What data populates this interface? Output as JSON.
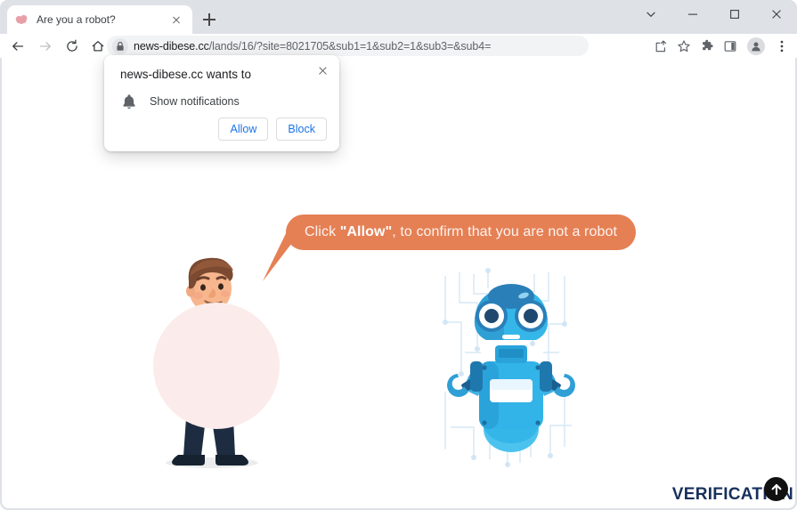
{
  "window": {
    "controls": {
      "tab_search": "tab-search-chevron",
      "minimize": "minimize",
      "maximize": "maximize",
      "close": "close"
    }
  },
  "tabs": [
    {
      "title": "Are you a robot?",
      "favicon": "page-favicon",
      "close_label": "close-tab"
    }
  ],
  "new_tab_label": "new-tab",
  "toolbar": {
    "back": "back",
    "forward": "forward",
    "reload": "reload",
    "home": "home",
    "share": "share",
    "bookmark": "bookmark-star",
    "extensions": "extensions-puzzle",
    "side_panel": "side-panel",
    "profile": "profile-avatar",
    "menu": "three-dot-menu"
  },
  "omnibox": {
    "lock_icon": "lock-icon",
    "host": "news-dibese.cc",
    "path": "/lands/16/?site=8021705&sub1=1&sub2=1&sub3=&sub4=",
    "full_url": "news-dibese.cc/lands/16/?site=8021705&sub1=1&sub2=1&sub3=&sub4="
  },
  "permission_dialog": {
    "title": "news-dibese.cc wants to",
    "option_icon": "bell-icon",
    "option_label": "Show notifications",
    "allow_label": "Allow",
    "block_label": "Block",
    "close_label": "close-dialog",
    "link_color": "#1a73e8"
  },
  "page": {
    "bubble": {
      "prefix": "Click ",
      "emphasis": "\"Allow\"",
      "suffix": ", to confirm that you are not a robot",
      "background_color": "#e58055",
      "text_color": "#fdf3ee"
    },
    "illustrations": {
      "man": "businessman-pointing-illustration",
      "robot": "blue-robot-illustration"
    },
    "verification_text": "VERIFICATION",
    "verification_color": "#17305c",
    "scroll_top_label": "scroll-to-top"
  }
}
